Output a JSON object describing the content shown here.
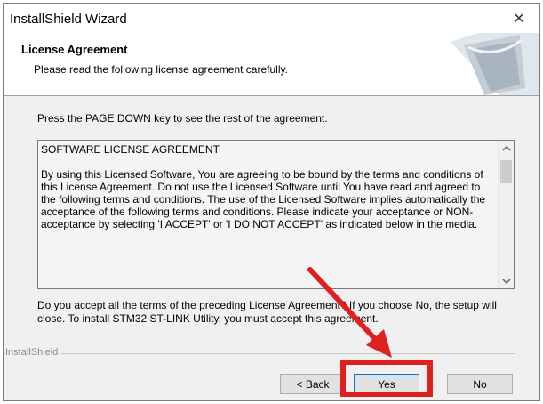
{
  "window": {
    "title": "InstallShield Wizard",
    "close_glyph": "✕"
  },
  "header": {
    "title": "License Agreement",
    "subtitle": "Please read the following license agreement carefully."
  },
  "instruction": "Press the PAGE DOWN key to see the rest of the agreement.",
  "license": {
    "text": "SOFTWARE LICENSE AGREEMENT\n\nBy using this Licensed Software, You are agreeing to be bound by the terms and conditions of this License Agreement. Do not use the Licensed Software until You have read and agreed to the following terms and conditions. The use of the Licensed Software implies automatically the acceptance of the following terms and conditions. Please indicate your acceptance or NON-acceptance by selecting 'I ACCEPT' or 'I DO NOT ACCEPT' as indicated below in the media."
  },
  "question": "Do you accept all the terms of the preceding License Agreement? If you choose No, the setup will close. To install STM32 ST-LINK Utility, you must accept this agreement.",
  "brand": "InstallShield",
  "buttons": {
    "back": "< Back",
    "yes": "Yes",
    "no": "No"
  },
  "icons": {
    "close": "close-icon",
    "scroll_up": "chevron-up-icon",
    "scroll_down": "chevron-down-icon",
    "annotation_arrow": "arrow-icon"
  },
  "colors": {
    "highlight": "#e0201f",
    "default_button_border": "#0078d7"
  }
}
